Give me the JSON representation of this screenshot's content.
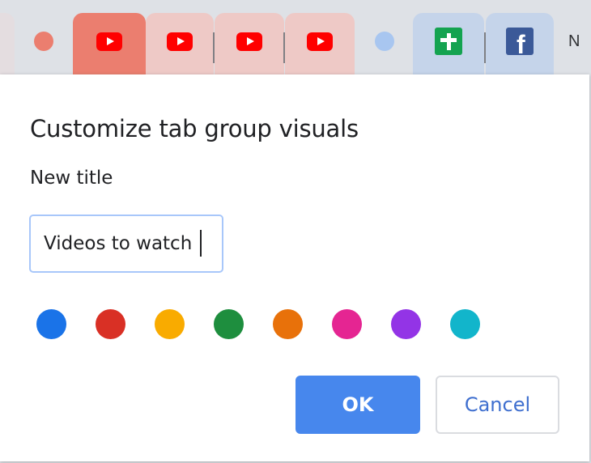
{
  "tab_strip": {
    "tabs": [
      {
        "name": "collapsed-group",
        "icon": "collapsed-group-dot",
        "color": "#eb7e6f"
      },
      {
        "name": "youtube-tab-1",
        "icon": "youtube-icon"
      },
      {
        "name": "youtube-tab-2",
        "icon": "youtube-icon"
      },
      {
        "name": "youtube-tab-3",
        "icon": "youtube-icon"
      },
      {
        "name": "youtube-tab-4",
        "icon": "youtube-icon"
      },
      {
        "name": "blue-group",
        "icon": "group-dot",
        "color": "#a8c6f0"
      },
      {
        "name": "sheets-tab",
        "icon": "google-sheets-icon"
      },
      {
        "name": "facebook-tab",
        "icon": "facebook-icon",
        "glyph": "f"
      },
      {
        "name": "new-tab-partial",
        "label": "N"
      }
    ]
  },
  "dialog": {
    "title": "Customize tab group visuals",
    "field_label": "New title",
    "input_value": "Videos to watch",
    "colors": [
      {
        "name": "blue",
        "hex": "#1a73e8"
      },
      {
        "name": "red",
        "hex": "#d93025"
      },
      {
        "name": "yellow",
        "hex": "#f9ab00"
      },
      {
        "name": "green",
        "hex": "#1e8e3e"
      },
      {
        "name": "orange",
        "hex": "#e8710a"
      },
      {
        "name": "pink",
        "hex": "#e52592"
      },
      {
        "name": "purple",
        "hex": "#9334e6"
      },
      {
        "name": "cyan",
        "hex": "#12b5cb"
      }
    ],
    "ok_label": "OK",
    "cancel_label": "Cancel"
  }
}
